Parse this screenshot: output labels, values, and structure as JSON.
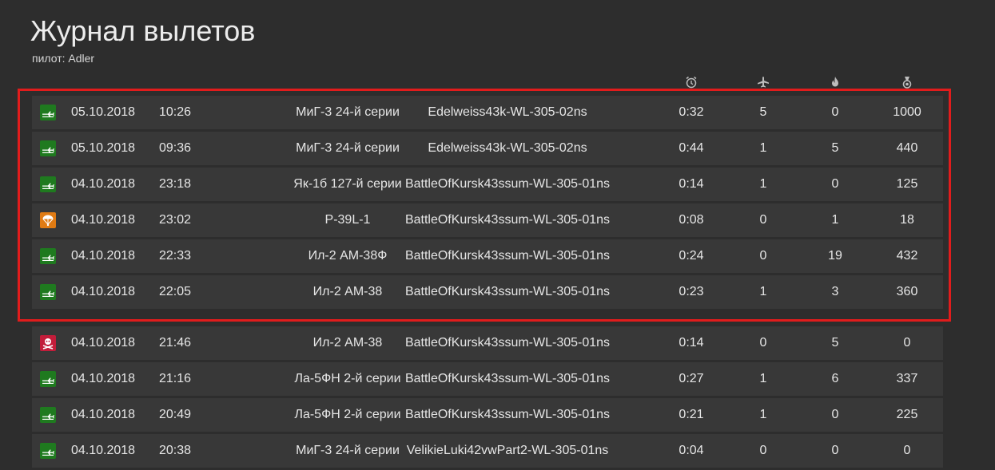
{
  "page": {
    "title": "Журнал вылетов",
    "subtitle": "пилот: Adler"
  },
  "header_icons": [
    "alarm-clock-icon",
    "airplane-icon",
    "fire-icon",
    "medal-icon"
  ],
  "colors": {
    "background": "#2d2d2d",
    "row": "#383838",
    "landed": "#1f7a1f",
    "bailed": "#e07b13",
    "killed": "#c21d3a",
    "highlight": "#e11c1c"
  },
  "sorties": [
    {
      "status": "landed",
      "date": "05.10.2018",
      "time": "10:26",
      "aircraft": "МиГ-3 24-й серии",
      "mission": "Edelweiss43k-WL-305-02ns",
      "duration": "0:32",
      "air_kills": "5",
      "ground_kills": "0",
      "score": "1000"
    },
    {
      "status": "landed",
      "date": "05.10.2018",
      "time": "09:36",
      "aircraft": "МиГ-3 24-й серии",
      "mission": "Edelweiss43k-WL-305-02ns",
      "duration": "0:44",
      "air_kills": "1",
      "ground_kills": "5",
      "score": "440"
    },
    {
      "status": "landed",
      "date": "04.10.2018",
      "time": "23:18",
      "aircraft": "Як-1б 127-й серии",
      "mission": "BattleOfKursk43ssum-WL-305-01ns",
      "duration": "0:14",
      "air_kills": "1",
      "ground_kills": "0",
      "score": "125"
    },
    {
      "status": "bailed",
      "date": "04.10.2018",
      "time": "23:02",
      "aircraft": "P-39L-1",
      "mission": "BattleOfKursk43ssum-WL-305-01ns",
      "duration": "0:08",
      "air_kills": "0",
      "ground_kills": "1",
      "score": "18"
    },
    {
      "status": "landed",
      "date": "04.10.2018",
      "time": "22:33",
      "aircraft": "Ил-2 АМ-38Ф",
      "mission": "BattleOfKursk43ssum-WL-305-01ns",
      "duration": "0:24",
      "air_kills": "0",
      "ground_kills": "19",
      "score": "432"
    },
    {
      "status": "landed",
      "date": "04.10.2018",
      "time": "22:05",
      "aircraft": "Ил-2 АМ-38",
      "mission": "BattleOfKursk43ssum-WL-305-01ns",
      "duration": "0:23",
      "air_kills": "1",
      "ground_kills": "3",
      "score": "360"
    },
    {
      "status": "killed",
      "date": "04.10.2018",
      "time": "21:46",
      "aircraft": "Ил-2 АМ-38",
      "mission": "BattleOfKursk43ssum-WL-305-01ns",
      "duration": "0:14",
      "air_kills": "0",
      "ground_kills": "5",
      "score": "0"
    },
    {
      "status": "landed",
      "date": "04.10.2018",
      "time": "21:16",
      "aircraft": "Ла-5ФН 2-й серии",
      "mission": "BattleOfKursk43ssum-WL-305-01ns",
      "duration": "0:27",
      "air_kills": "1",
      "ground_kills": "6",
      "score": "337"
    },
    {
      "status": "landed",
      "date": "04.10.2018",
      "time": "20:49",
      "aircraft": "Ла-5ФН 2-й серии",
      "mission": "BattleOfKursk43ssum-WL-305-01ns",
      "duration": "0:21",
      "air_kills": "1",
      "ground_kills": "0",
      "score": "225"
    },
    {
      "status": "landed",
      "date": "04.10.2018",
      "time": "20:38",
      "aircraft": "МиГ-3 24-й серии",
      "mission": "VelikieLuki42vwPart2-WL-305-01ns",
      "duration": "0:04",
      "air_kills": "0",
      "ground_kills": "0",
      "score": "0"
    }
  ]
}
